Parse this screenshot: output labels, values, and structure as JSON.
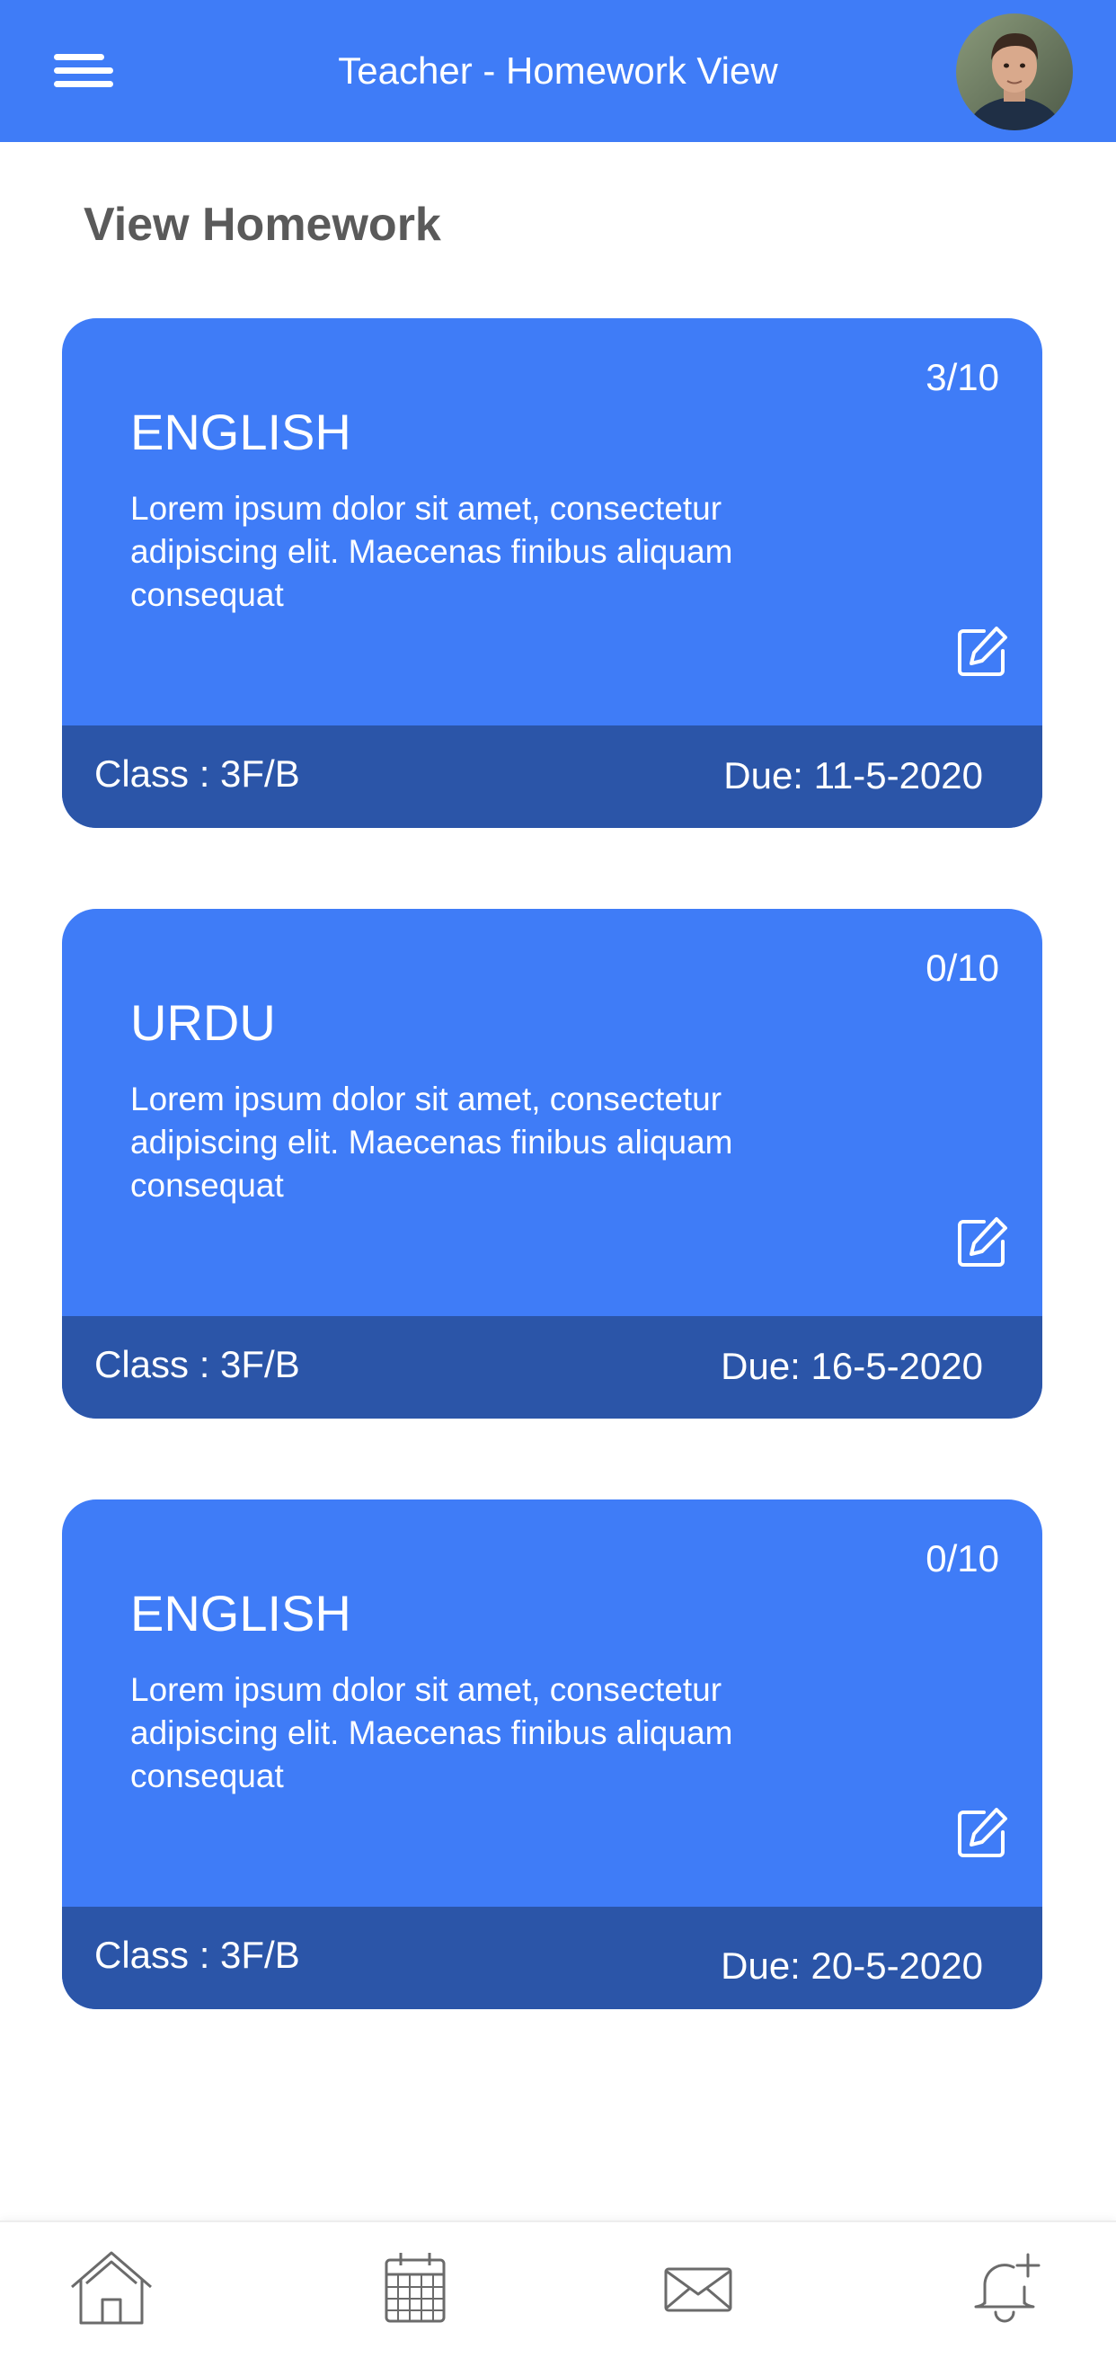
{
  "header": {
    "title": "Teacher - Homework View",
    "menu_icon": "hamburger-menu-icon",
    "avatar": "profile-avatar"
  },
  "page": {
    "title": "View Homework"
  },
  "homework": [
    {
      "count": "3/10",
      "subject": "ENGLISH",
      "description": "Lorem ipsum dolor sit amet, consectetur adipiscing elit. Maecenas finibus aliquam consequat",
      "class": "Class : 3F/B",
      "due": "Due: 11-5-2020",
      "edit_icon": "edit-icon"
    },
    {
      "count": "0/10",
      "subject": "URDU",
      "description": "Lorem ipsum dolor sit amet, consectetur adipiscing elit. Maecenas finibus aliquam consequat",
      "class": "Class : 3F/B",
      "due": "Due: 16-5-2020",
      "edit_icon": "edit-icon"
    },
    {
      "count": "0/10",
      "subject": "ENGLISH",
      "description": "Lorem ipsum dolor sit amet, consectetur adipiscing elit. Maecenas finibus aliquam consequat",
      "class": "Class : 3F/B",
      "due": "Due: 20-5-2020",
      "edit_icon": "edit-icon"
    }
  ],
  "bottom_nav": [
    {
      "icon": "home-icon"
    },
    {
      "icon": "calendar-icon"
    },
    {
      "icon": "mail-icon"
    },
    {
      "icon": "notification-bell-icon"
    }
  ],
  "colors": {
    "primary": "#3f7cf7",
    "card_footer": "#2b55a8",
    "title_text": "#5a5a5a",
    "nav_icon": "#6b6b6b"
  }
}
